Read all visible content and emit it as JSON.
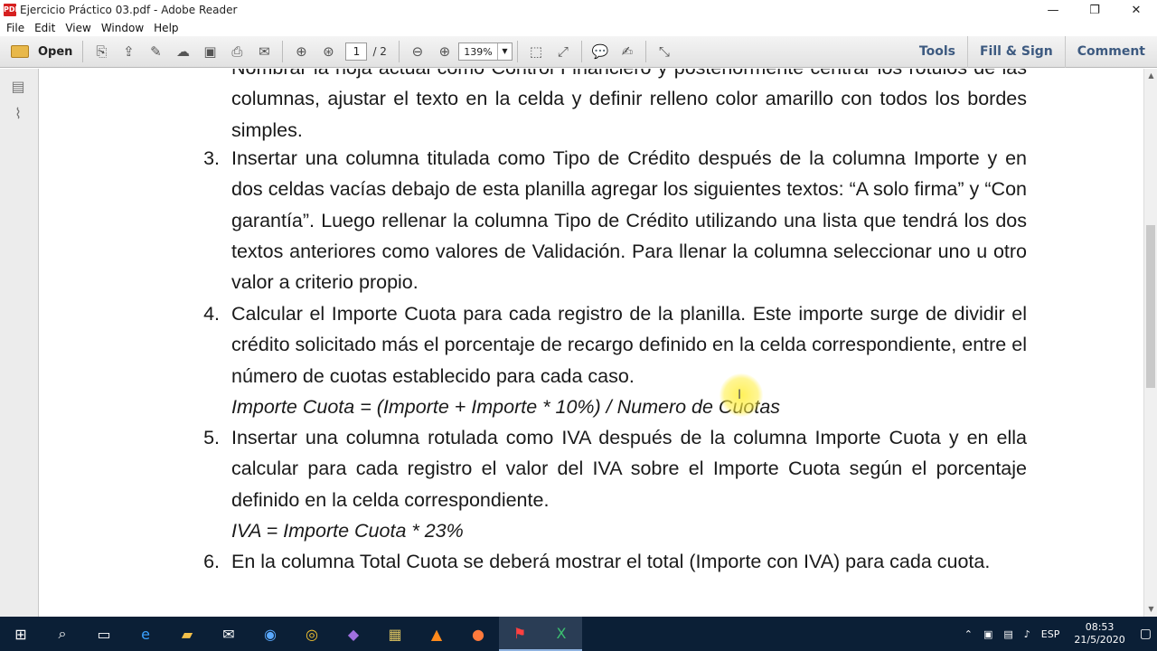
{
  "window": {
    "title": "Ejercicio Práctico 03.pdf - Adobe Reader",
    "controls": {
      "minimize": "—",
      "restore": "❐",
      "close": "✕"
    }
  },
  "menu": [
    "File",
    "Edit",
    "View",
    "Window",
    "Help"
  ],
  "toolbar": {
    "open_label": "Open",
    "page_current": "1",
    "page_total": "/ 2",
    "zoom": "139%",
    "right_links": [
      "Tools",
      "Fill & Sign",
      "Comment"
    ]
  },
  "document": {
    "items": [
      {
        "number": "",
        "text": "Nombrar la hoja actual como Control Financiero y posteriormente centrar los rótulos de las columnas, ajustar el texto en la celda y definir relleno color amarillo con todos los bordes simples.",
        "formula": ""
      },
      {
        "number": "3.",
        "text": "Insertar una columna titulada como Tipo de Crédito después de la columna Importe y en dos celdas vacías debajo de esta planilla agregar los siguientes textos: “A solo firma” y “Con garantía”. Luego rellenar la columna Tipo de Crédito utilizando una lista que tendrá los dos textos anteriores como valores de Validación. Para llenar la columna seleccionar uno u otro valor a criterio propio.",
        "formula": ""
      },
      {
        "number": "4.",
        "text": "Calcular el Importe Cuota para cada registro de la planilla. Este importe surge de dividir el crédito solicitado más el porcentaje de recargo definido en la celda correspondiente, entre el número de cuotas establecido para cada caso.",
        "formula": "Importe Cuota = (Importe + Importe * 10%) / Numero de Cuotas"
      },
      {
        "number": "5.",
        "text": "Insertar una columna rotulada como IVA después de la columna Importe Cuota y en ella calcular para cada registro el valor del IVA sobre el Importe Cuota según el porcentaje definido en la celda correspondiente.",
        "formula": "IVA = Importe Cuota * 23%"
      },
      {
        "number": "6.",
        "text": "En la columna Total Cuota se deberá mostrar el total (Importe con IVA) para cada cuota.",
        "formula": ""
      }
    ]
  },
  "taskbar": {
    "language": "ESP",
    "time": "08:53",
    "date": "21/5/2020"
  }
}
